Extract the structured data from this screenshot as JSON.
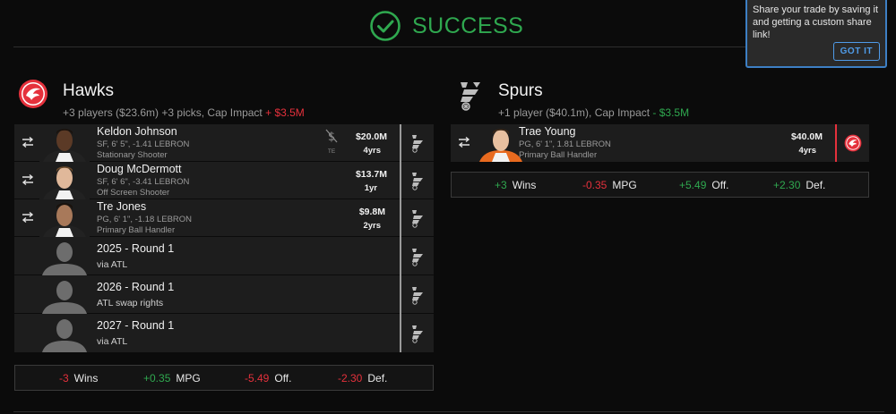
{
  "banner": {
    "title": "SUCCESS"
  },
  "tooltip": {
    "text": "Share your trade by saving it and getting a custom share link!",
    "button": "GOT IT"
  },
  "left": {
    "team": "Hawks",
    "summary": "+3 players ($23.6m) +3 picks, Cap Impact ",
    "cap_impact": "+ $3.5M",
    "players": [
      {
        "name": "Keldon Johnson",
        "meta1": "SF, 6' 5\", -1.41 LEBRON",
        "meta2": "Stationary Shooter",
        "salary": "$20.0M",
        "years": "4yrs",
        "te": "TE"
      },
      {
        "name": "Doug McDermott",
        "meta1": "SF, 6' 6\", -3.41 LEBRON",
        "meta2": "Off Screen Shooter",
        "salary": "$13.7M",
        "years": "1yr"
      },
      {
        "name": "Tre Jones",
        "meta1": "PG, 6' 1\", -1.18 LEBRON",
        "meta2": "Primary Ball Handler",
        "salary": "$9.8M",
        "years": "2yrs"
      }
    ],
    "picks": [
      {
        "name": "2025 - Round 1",
        "via": "via ATL"
      },
      {
        "name": "2026 - Round 1",
        "via": "ATL swap rights"
      },
      {
        "name": "2027 - Round 1",
        "via": "via ATL"
      }
    ],
    "stats": [
      {
        "value": "-3",
        "label": "Wins"
      },
      {
        "value": "+0.35",
        "label": "MPG"
      },
      {
        "value": "-5.49",
        "label": "Off."
      },
      {
        "value": "-2.30",
        "label": "Def."
      }
    ]
  },
  "right": {
    "team": "Spurs",
    "summary": "+1 player ($40.1m), Cap Impact ",
    "cap_impact": "- $3.5M",
    "players": [
      {
        "name": "Trae Young",
        "meta1": "PG, 6' 1\", 1.81 LEBRON",
        "meta2": "Primary Ball Handler",
        "salary": "$40.0M",
        "years": "4yrs"
      }
    ],
    "stats": [
      {
        "value": "+3",
        "label": "Wins"
      },
      {
        "value": "-0.35",
        "label": "MPG"
      },
      {
        "value": "+5.49",
        "label": "Off."
      },
      {
        "value": "+2.30",
        "label": "Def."
      }
    ]
  },
  "colors": {
    "success": "#2fa84f",
    "negative": "#e5313c",
    "accent": "#3d7fc4",
    "hawks": "#e5313c"
  },
  "icons": [
    "check-circle-icon",
    "hawks-logo-icon",
    "spurs-logo-icon",
    "swap-icon",
    "no-dollar-icon",
    "player-silhouette-icon"
  ]
}
